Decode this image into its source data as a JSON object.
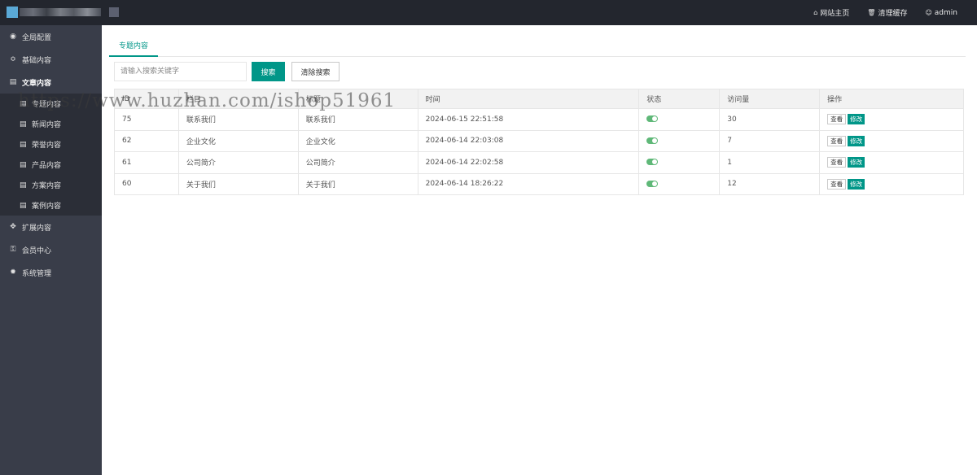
{
  "header": {
    "nav": [
      {
        "icon": "home-icon",
        "glyph": "⌂",
        "label": "网站主页"
      },
      {
        "icon": "trash-icon",
        "glyph": "🗑",
        "label": "清理缓存"
      },
      {
        "icon": "user-icon",
        "glyph": "☺",
        "label": "admin"
      }
    ]
  },
  "sidebar": {
    "items": [
      {
        "icon": "globe-icon",
        "glyph": "◉",
        "label": "全局配置"
      },
      {
        "icon": "sliders-icon",
        "glyph": "≎",
        "label": "基础内容"
      },
      {
        "icon": "file-icon",
        "glyph": "▤",
        "label": "文章内容"
      }
    ],
    "sub_items": [
      {
        "label": "专题内容"
      },
      {
        "label": "新闻内容"
      },
      {
        "label": "荣誉内容"
      },
      {
        "label": "产品内容"
      },
      {
        "label": "方案内容"
      },
      {
        "label": "案例内容"
      }
    ],
    "bottom_items": [
      {
        "icon": "expand-icon",
        "glyph": "✥",
        "label": "扩展内容"
      },
      {
        "icon": "lock-icon",
        "glyph": "⚿",
        "label": "会员中心"
      },
      {
        "icon": "gear-icon",
        "glyph": "✹",
        "label": "系统管理"
      }
    ]
  },
  "main": {
    "tab_label": "专题内容",
    "search": {
      "placeholder": "请输入搜索关键字",
      "search_label": "搜索",
      "clear_label": "清除搜索"
    },
    "table": {
      "headers": [
        "ID",
        "栏目",
        "标题",
        "时间",
        "状态",
        "访问量",
        "操作"
      ],
      "view_label": "查看",
      "edit_label": "修改",
      "rows": [
        {
          "id": "75",
          "column": "联系我们",
          "title": "联系我们",
          "time": "2024-06-15 22:51:58",
          "status": "on",
          "visits": "30"
        },
        {
          "id": "62",
          "column": "企业文化",
          "title": "企业文化",
          "time": "2024-06-14 22:03:08",
          "status": "on",
          "visits": "7"
        },
        {
          "id": "61",
          "column": "公司简介",
          "title": "公司简介",
          "time": "2024-06-14 22:02:58",
          "status": "on",
          "visits": "1"
        },
        {
          "id": "60",
          "column": "关于我们",
          "title": "关于我们",
          "time": "2024-06-14 18:26:22",
          "status": "on",
          "visits": "12"
        }
      ]
    }
  },
  "watermark": "https://www.huzhan.com/ishop51961",
  "colors": {
    "accent": "#009688",
    "header_bg": "#23262e",
    "sidebar_bg": "#393d49",
    "toggle_on": "#5fb878"
  }
}
